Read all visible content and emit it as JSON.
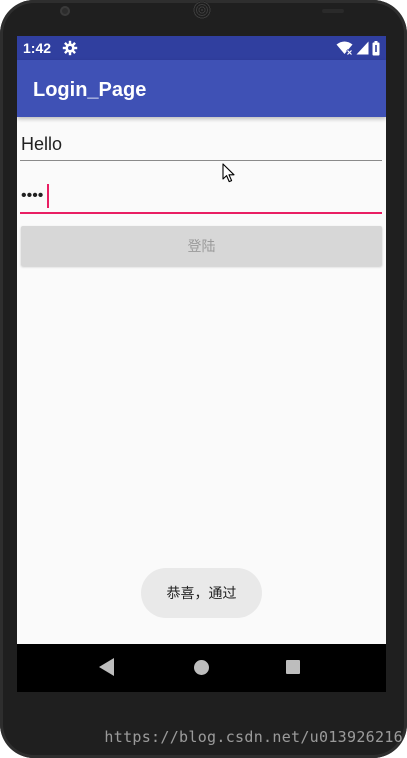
{
  "status_bar": {
    "time": "1:42",
    "settings_icon": "gear-icon",
    "icons": [
      "wifi-icon",
      "signal-icon",
      "battery-icon"
    ]
  },
  "app_bar": {
    "title": "Login_Page"
  },
  "form": {
    "username_value": "Hello",
    "password_value": "••••",
    "login_button_label": "登陆"
  },
  "toast": {
    "message": "恭喜，通过"
  },
  "nav_bar": {
    "icons": [
      "back-icon",
      "home-icon",
      "recents-icon"
    ]
  },
  "watermark": {
    "text": "https://blog.csdn.net/u013926216"
  },
  "colors": {
    "status_bar": "#303f9f",
    "app_bar": "#3f51b5",
    "accent": "#e91e63",
    "button_disabled": "#d7d7d7",
    "background": "#fafafa"
  }
}
